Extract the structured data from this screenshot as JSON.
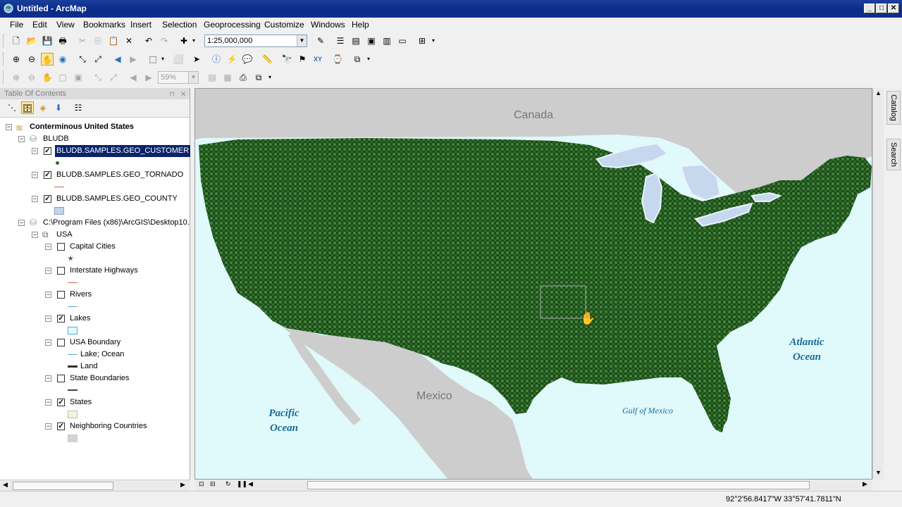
{
  "window": {
    "title": "Untitled - ArcMap"
  },
  "menu": [
    "File",
    "Edit",
    "View",
    "Bookmarks",
    "Insert",
    "Selection",
    "Geoprocessing",
    "Customize",
    "Windows",
    "Help"
  ],
  "toolbar": {
    "scale": "1:25,000,000",
    "zoom_percent": "59%"
  },
  "toc": {
    "title": "Table Of Contents",
    "dataframe": "Conterminous United States",
    "group1": {
      "name": "BLUDB",
      "layers": [
        {
          "name": "BLUDB.SAMPLES.GEO_CUSTOMER",
          "checked": true
        },
        {
          "name": "BLUDB.SAMPLES.GEO_TORNADO",
          "checked": true
        },
        {
          "name": "BLUDB.SAMPLES.GEO_COUNTY",
          "checked": true
        }
      ]
    },
    "group2": {
      "name": "C:\\Program Files (x86)\\ArcGIS\\Desktop10.:",
      "subgroup": "USA",
      "layers": [
        {
          "name": "Capital Cities",
          "checked": false
        },
        {
          "name": "Interstate Highways",
          "checked": false
        },
        {
          "name": "Rivers",
          "checked": false
        },
        {
          "name": "Lakes",
          "checked": true
        },
        {
          "name": "USA Boundary",
          "checked": false,
          "classes": [
            "Lake; Ocean",
            "Land"
          ]
        },
        {
          "name": "State Boundaries",
          "checked": false
        },
        {
          "name": "States",
          "checked": true
        },
        {
          "name": "Neighboring Countries",
          "checked": true
        }
      ]
    }
  },
  "map": {
    "labels": {
      "canada": "Canada",
      "mexico": "Mexico",
      "pacific": "Pacific Ocean",
      "atlantic": "Atlantic Ocean",
      "gulf": "Gulf of Mexico"
    },
    "colors": {
      "water": "#e0f9fb",
      "land": "#cdcdcd",
      "points": "#2f6b2a",
      "lakes": "#c6d8ee"
    }
  },
  "side_tabs": [
    "Catalog",
    "Search"
  ],
  "status": {
    "coordinates": "92°2'56.8417\"W  33°57'41.7811\"N"
  }
}
